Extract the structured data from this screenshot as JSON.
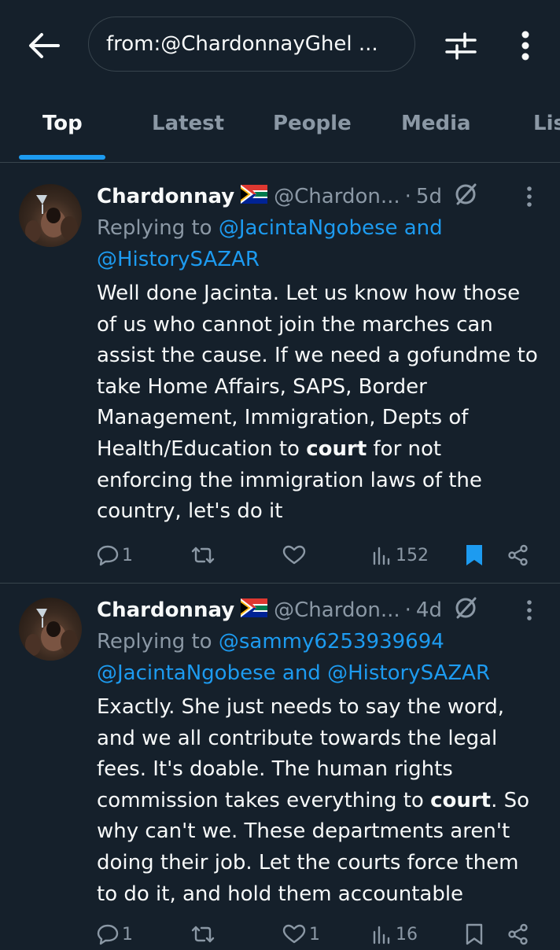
{
  "search": {
    "query": "from:@ChardonnayGhel ..."
  },
  "tabs": [
    {
      "label": "Top",
      "active": true
    },
    {
      "label": "Latest",
      "active": false
    },
    {
      "label": "People",
      "active": false
    },
    {
      "label": "Media",
      "active": false
    },
    {
      "label": "Lis",
      "active": false
    }
  ],
  "colors": {
    "accent": "#1d9bf0",
    "background": "#15202b",
    "muted": "#8b98a5"
  },
  "tweets": [
    {
      "name": "Chardonnay",
      "handle": "@Chardon...",
      "dot": "·",
      "time": "5d",
      "replying_prefix": "Replying to ",
      "mentions_line1": "@JacintaNgobese and",
      "mentions_line2": "@HistorySAZAR",
      "text_before": "Well done Jacinta. Let us know how those of us who cannot join the marches can assist the cause. If we need a gofundme to take Home Affairs, SAPS, Border Management, Immigration, Depts of Health/Education to ",
      "text_bold": "court",
      "text_after": " for not enforcing the immigration laws of the country, let's do it",
      "replies": "1",
      "retweets": "",
      "likes": "",
      "views": "152",
      "bookmarked": true
    },
    {
      "name": "Chardonnay",
      "handle": "@Chardon...",
      "dot": "·",
      "time": "4d",
      "replying_prefix": "Replying to ",
      "mentions_line1": "@sammy6253939694",
      "mentions_line2": "@JacintaNgobese and @HistorySAZAR",
      "text_before": "Exactly. She just needs to say the word, and we all contribute towards the legal fees. It's doable. The human rights commission takes everything to ",
      "text_bold": "court",
      "text_after": ". So why can't we. These departments aren't doing their job. Let the courts force them to do it, and hold them accountable",
      "replies": "1",
      "retweets": "",
      "likes": "1",
      "views": "16",
      "bookmarked": false
    }
  ]
}
